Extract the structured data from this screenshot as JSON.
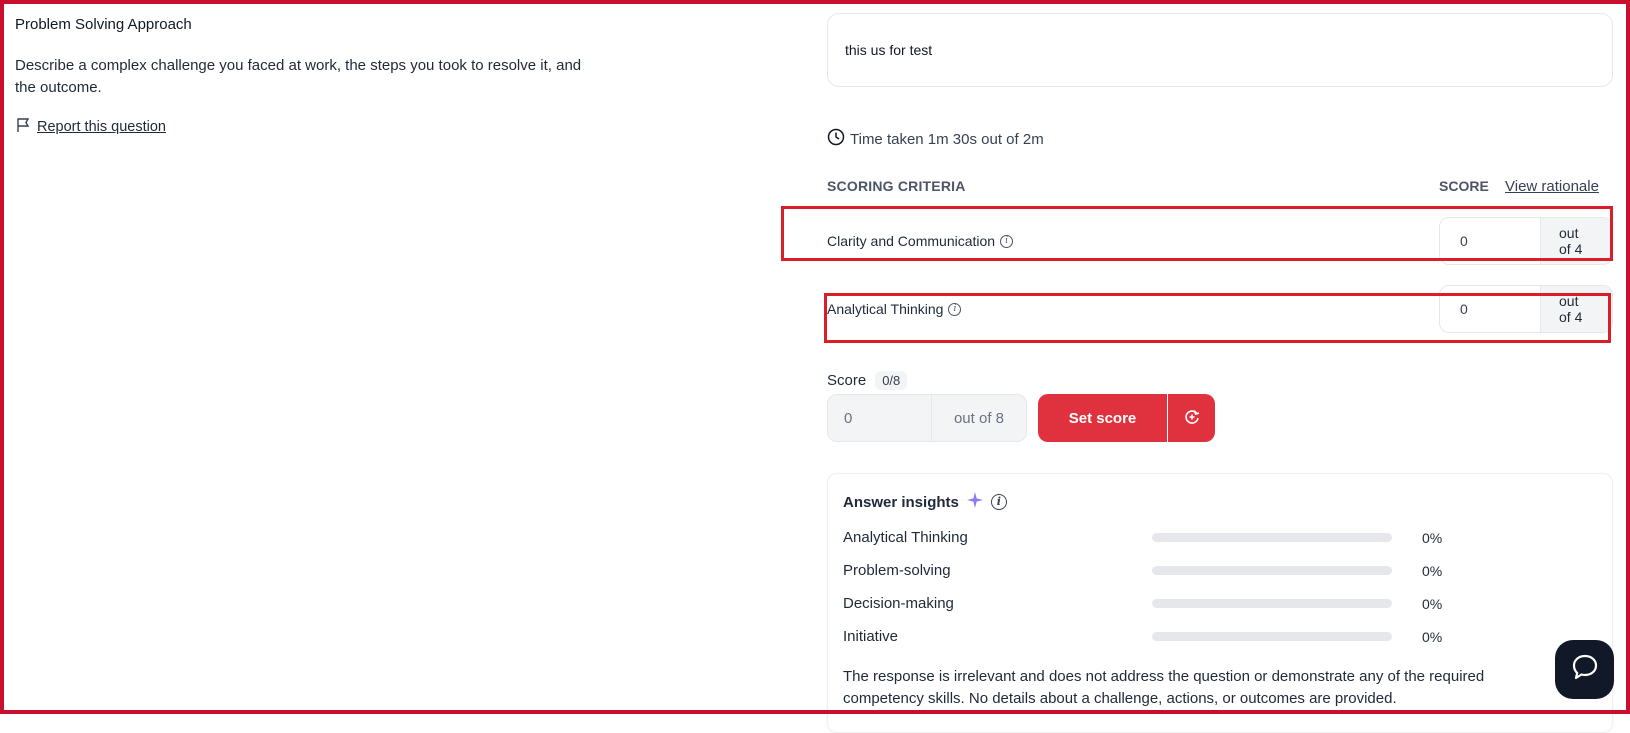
{
  "question": {
    "title": "Problem Solving Approach",
    "description": "Describe a complex challenge you faced at work, the steps you took to resolve it, and the outcome.",
    "report_label": "Report this question"
  },
  "answer": {
    "text": "this us for test",
    "time_taken": "Time taken 1m 30s out of 2m"
  },
  "scoring": {
    "criteria_header": "SCORING CRITERIA",
    "score_header": "SCORE",
    "view_rationale": "View rationale",
    "criteria": [
      {
        "label": "Clarity and Communication",
        "value": "0",
        "out_of": "out of 4"
      },
      {
        "label": "Analytical Thinking",
        "value": "0",
        "out_of": "out of 4"
      }
    ]
  },
  "total": {
    "label": "Score",
    "badge": "0/8",
    "value": "0",
    "out_of": "out of 8",
    "set_score": "Set score"
  },
  "insights": {
    "title": "Answer insights",
    "rows": [
      {
        "label": "Analytical Thinking",
        "pct": "0%",
        "fill": 0
      },
      {
        "label": "Problem-solving",
        "pct": "0%",
        "fill": 0
      },
      {
        "label": "Decision-making",
        "pct": "0%",
        "fill": 0
      },
      {
        "label": "Initiative",
        "pct": "0%",
        "fill": 0
      }
    ],
    "summary": "The response is irrelevant and does not address the question or demonstrate any of the required competency skills. No details about a challenge, actions, or outcomes are provided."
  },
  "colors": {
    "accent_red": "#e0313f",
    "highlight_red": "#d91e2a",
    "sparkle_purple": "#8b7cf6"
  }
}
